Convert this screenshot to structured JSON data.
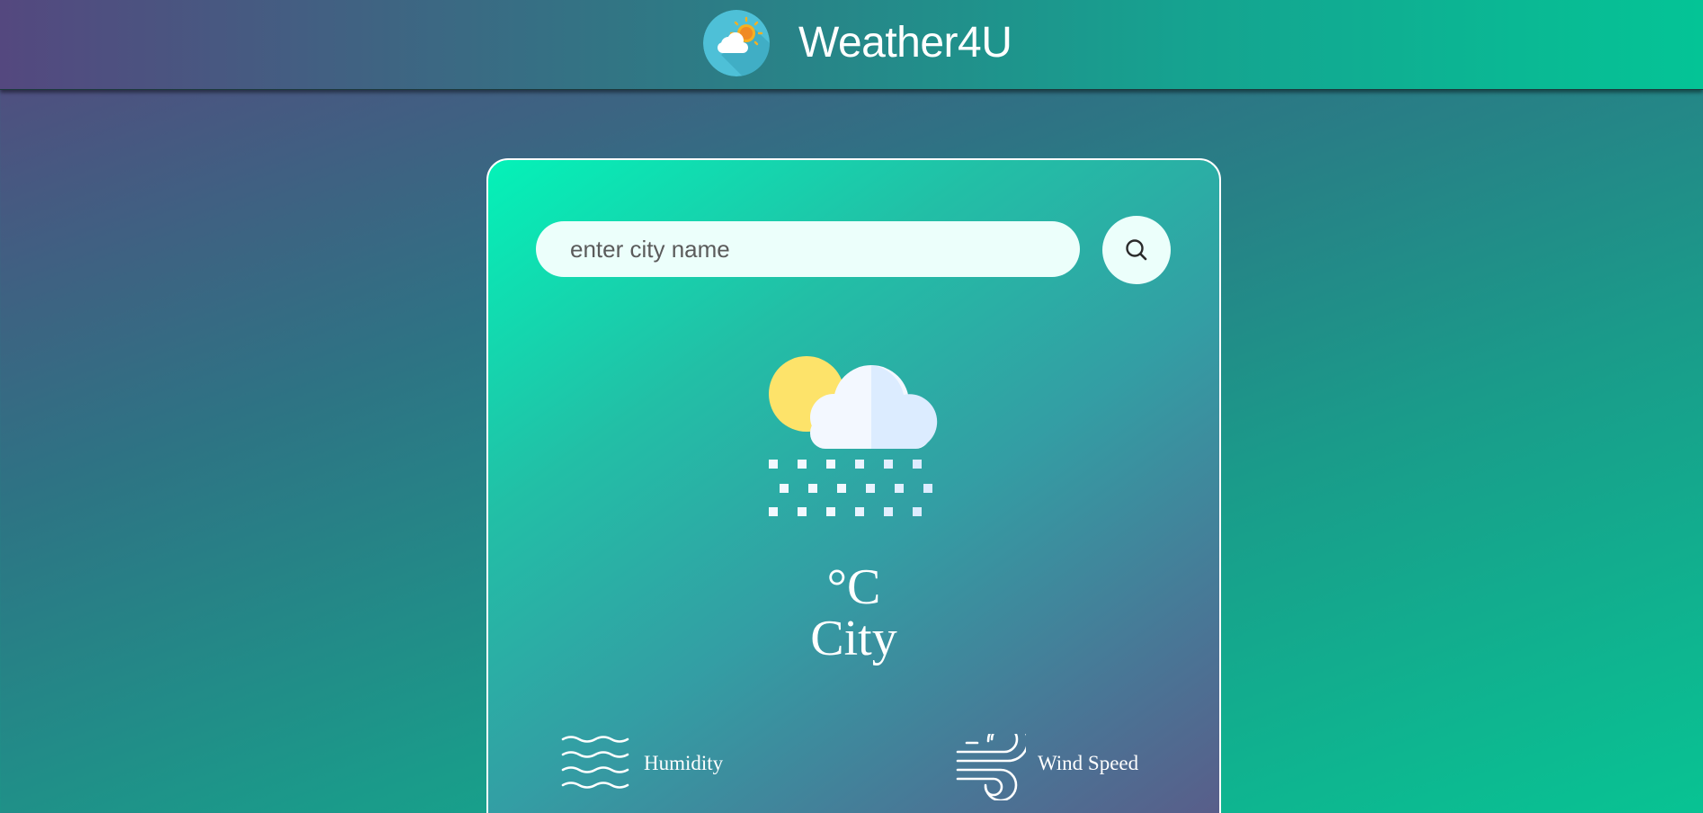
{
  "header": {
    "app_title": "Weather4U",
    "logo_icon": "sun-cloud-logo-icon"
  },
  "search": {
    "placeholder": "enter city name",
    "value": "",
    "button_icon": "search-icon"
  },
  "weather": {
    "condition_icon": "sun-cloud-snow-icon",
    "temperature": "°C",
    "city": "City"
  },
  "details": {
    "humidity": {
      "label": "Humidity",
      "icon": "humidity-waves-icon"
    },
    "wind": {
      "label": "Wind Speed",
      "icon": "wind-icon"
    }
  },
  "colors": {
    "accent": "#04f2b8",
    "input_background": "#ecfffb",
    "text": "#ffffff",
    "sun": "#fde36a",
    "cloud": "#f3f8ff"
  }
}
